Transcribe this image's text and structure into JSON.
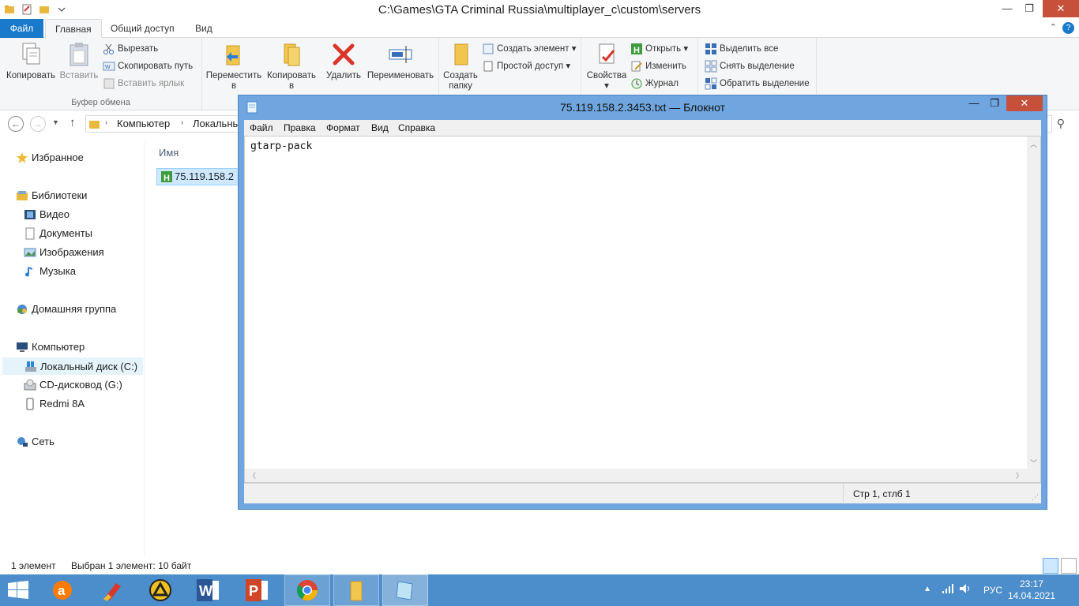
{
  "explorer": {
    "title": "C:\\Games\\GTA Criminal Russia\\multiplayer_c\\custom\\servers",
    "tabs": [
      {
        "label": "Файл"
      },
      {
        "label": "Главная"
      },
      {
        "label": "Общий доступ"
      },
      {
        "label": "Вид"
      }
    ],
    "ribbon": {
      "clipboard": {
        "copy": "Копировать",
        "paste": "Вставить",
        "cut": "Вырезать",
        "copy_path": "Скопировать путь",
        "paste_shortcut": "Вставить ярлык",
        "group_label": "Буфер обмена"
      },
      "organize": {
        "move": "Переместить\nв",
        "move_line1": "Переместить",
        "move_line2": "в",
        "copy_to_line1": "Копировать",
        "copy_to_line2": "в",
        "delete": "Удалить",
        "rename": "Переименовать"
      },
      "new": {
        "new_folder_line1": "Создать",
        "new_folder_line2": "папку",
        "new_item": "Создать элемент",
        "easy_access": "Простой доступ"
      },
      "open": {
        "properties": "Свойства",
        "open": "Открыть",
        "edit": "Изменить",
        "history": "Журнал"
      },
      "select": {
        "select_all": "Выделить все",
        "select_none": "Снять выделение",
        "invert": "Обратить выделение"
      }
    },
    "address": {
      "crumbs": [
        "Компьютер",
        "Локальны"
      ]
    },
    "nav": {
      "favorites": "Избранное",
      "libraries": "Библиотеки",
      "video": "Видео",
      "documents": "Документы",
      "images": "Изображения",
      "music": "Музыка",
      "homegroup": "Домашняя группа",
      "computer": "Компьютер",
      "local_disk": "Локальный диск (C:)",
      "cd_drive": "CD-дисковод (G:)",
      "redmi": "Redmi 8A",
      "network": "Сеть"
    },
    "content": {
      "column_name": "Имя",
      "file_name": "75.119.158.2"
    },
    "status": {
      "count": "1 элемент",
      "selected": "Выбран 1 элемент: 10 байт"
    }
  },
  "notepad": {
    "title": "75.119.158.2.3453.txt — Блокнот",
    "menu": [
      "Файл",
      "Правка",
      "Формат",
      "Вид",
      "Справка"
    ],
    "text": "gtarp-pack",
    "status_pos": "Стр 1, стлб 1"
  },
  "taskbar": {
    "apps": [
      "start-icon",
      "avast-icon",
      "ccleaner-icon",
      "archicad-icon",
      "word-icon",
      "powerpoint-icon",
      "chrome-icon",
      "explorer-icon",
      "notepad-icon"
    ],
    "lang": "РУС",
    "time": "23:17",
    "date": "14.04.2021"
  },
  "colors": {
    "accent": "#1979ca",
    "taskbar": "#4c8dcb",
    "notepad_frame": "#6fa6e0",
    "close": "#c7503a"
  }
}
